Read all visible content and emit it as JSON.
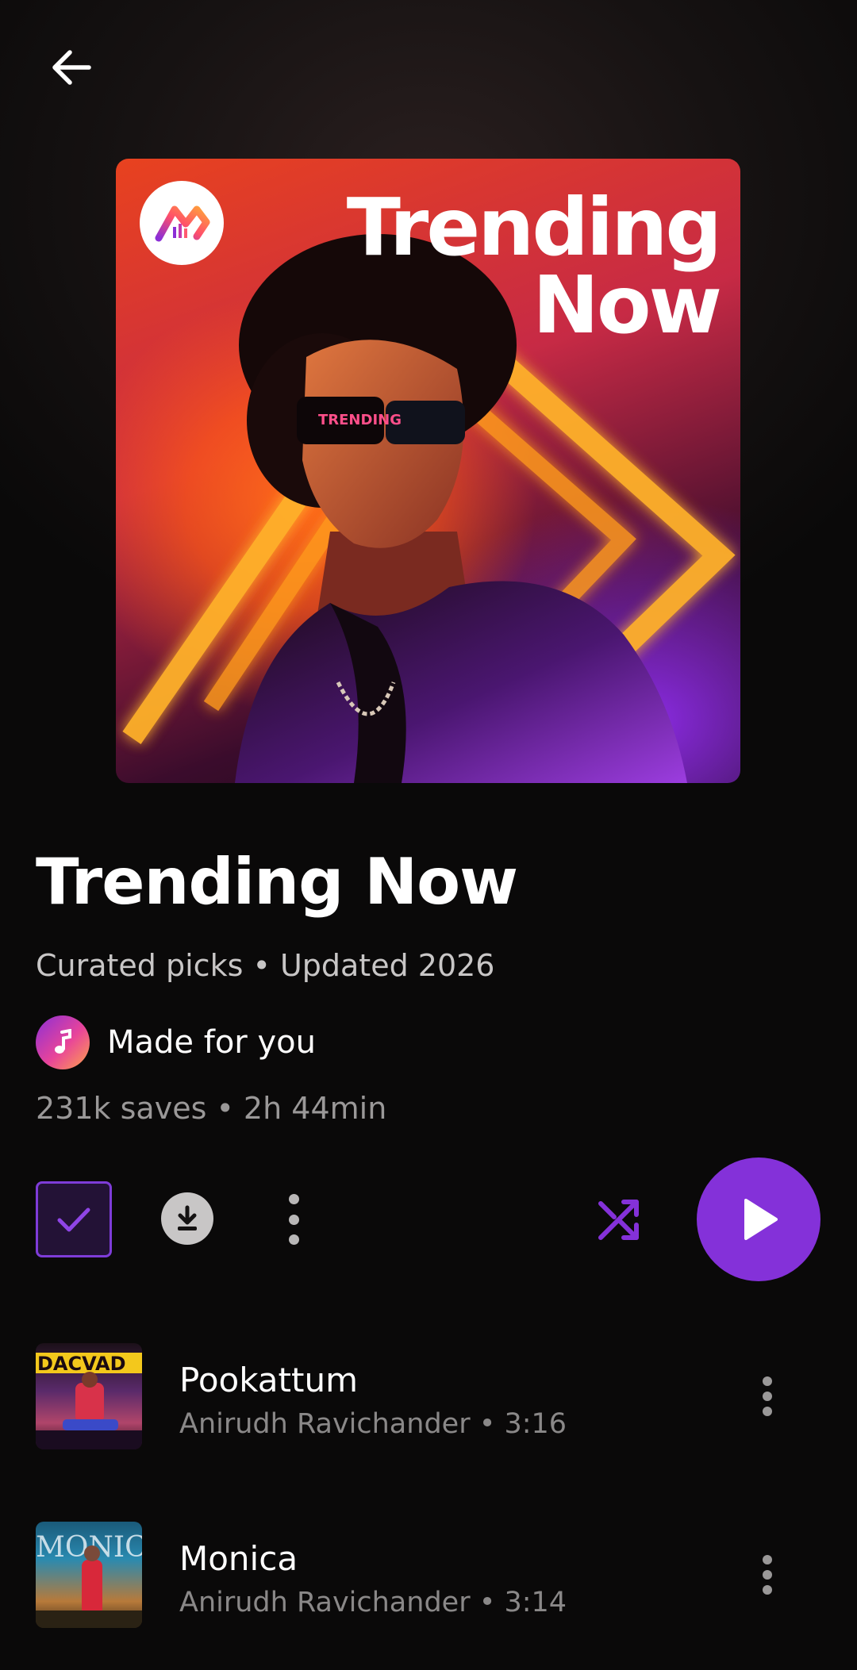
{
  "header": {
    "back_icon": "arrow-left-icon"
  },
  "cover": {
    "title": "Trending\nNow",
    "logo_icon": "trending-logo-icon",
    "glasses_text": "TRENDING"
  },
  "playlist": {
    "title": "Trending Now",
    "subtitle": "Curated picks • Updated 2026",
    "made_for": "Made for you",
    "stats": "231k saves • 2h 44min"
  },
  "actions": {
    "saved_icon": "check-icon",
    "download_icon": "download-icon",
    "more_icon": "more-vertical-icon",
    "shuffle_icon": "shuffle-icon",
    "play_icon": "play-icon"
  },
  "colors": {
    "accent": "#8431d9",
    "background": "#0a0909"
  },
  "tracks": [
    {
      "title": "Pookattum",
      "meta": "Anirudh Ravichander • 3:16",
      "thumb_text": "DACVAD"
    },
    {
      "title": "Monica",
      "meta": "Anirudh Ravichander • 3:14",
      "thumb_text": "MONICA"
    }
  ]
}
